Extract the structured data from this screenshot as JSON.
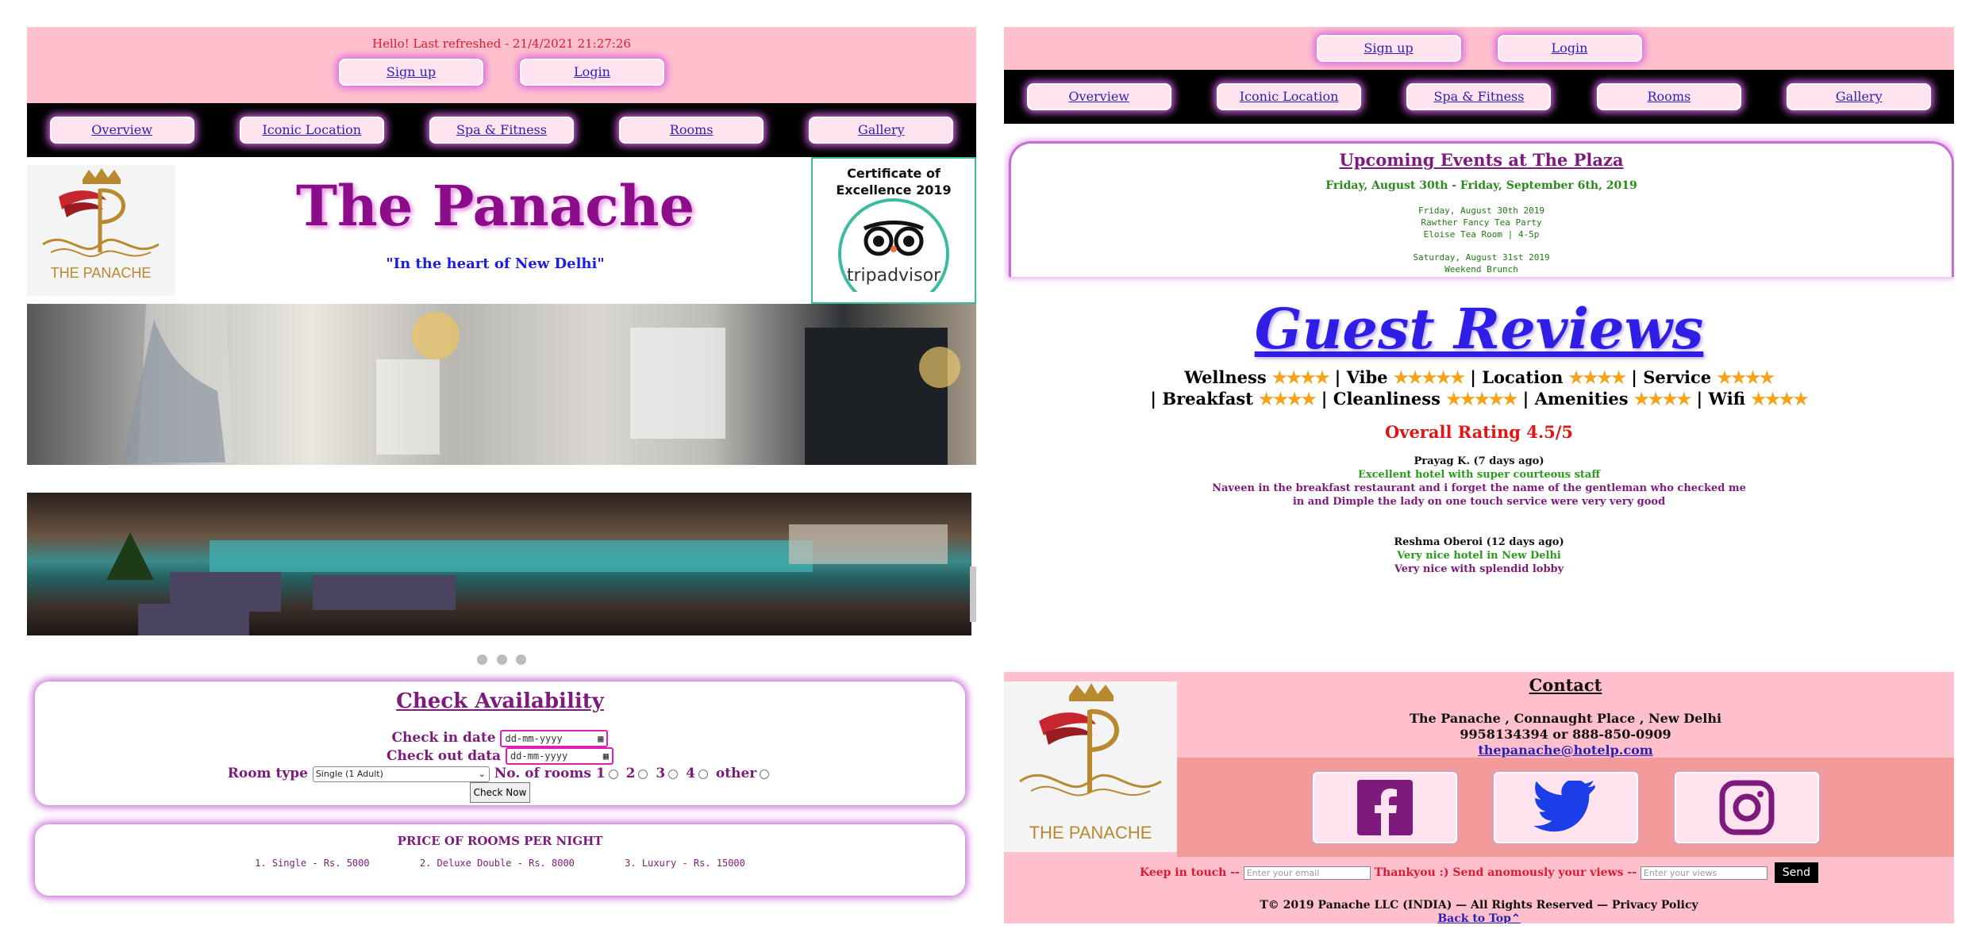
{
  "left": {
    "greeting": "Hello! Last refreshed - 21/4/2021 21:27:26",
    "auth": {
      "signup": "Sign up",
      "login": "Login"
    },
    "nav": [
      "Overview",
      "Iconic Location",
      "Spa & Fitness",
      "Rooms",
      "Gallery"
    ],
    "brand": {
      "logo_text": "THE PANACHE",
      "title": "The Panache",
      "tagline": "\"In the heart of New Delhi\"",
      "certificate": "Certificate of Excellence 2019",
      "certificate_brand": "tripadvisor"
    },
    "carousel_dots": 3,
    "availability": {
      "heading": "Check Availability",
      "checkin_label": "Check in date",
      "checkout_label": "Check out data",
      "date_placeholder": "dd-mm-yyyy",
      "roomtype_label": "Room type",
      "roomtype_value": "Single (1 Adult)",
      "rooms_label": "No. of rooms",
      "room_options": [
        "1",
        "2",
        "3",
        "4",
        "other"
      ],
      "submit": "Check Now"
    },
    "prices": {
      "heading": "PRICE OF ROOMS PER NIGHT",
      "items": [
        "1. Single - Rs. 5000",
        "2. Deluxe Double - Rs. 8000",
        "3. Luxury - Rs. 15000"
      ]
    }
  },
  "right": {
    "auth": {
      "signup": "Sign up",
      "login": "Login"
    },
    "nav": [
      "Overview",
      "Iconic Location",
      "Spa & Fitness",
      "Rooms",
      "Gallery"
    ],
    "events": {
      "heading": "Upcoming Events at The Plaza",
      "range": "Friday, August 30th - Friday, September 6th, 2019",
      "e1": [
        "Friday, August 30th 2019",
        "Rawther Fancy Tea Party",
        "Eloise Tea Room | 4-5p"
      ],
      "e2": [
        "Saturday, August 31st 2019",
        "Weekend Brunch"
      ]
    },
    "reviews": {
      "heading": "Guest Reviews",
      "line1": [
        {
          "label": "Wellness",
          "stars": "★★★★"
        },
        {
          "label": "Vibe",
          "stars": "★★★★★"
        },
        {
          "label": "Location",
          "stars": "★★★★"
        },
        {
          "label": "Service",
          "stars": "★★★★"
        }
      ],
      "line2": [
        {
          "label": "Breakfast",
          "stars": "★★★★"
        },
        {
          "label": "Cleanliness",
          "stars": "★★★★★"
        },
        {
          "label": "Amenities",
          "stars": "★★★★"
        },
        {
          "label": "Wifi",
          "stars": "★★★★"
        }
      ],
      "overall": "Overall Rating 4.5/5",
      "r1": {
        "name": "Prayag K. (7 days ago)",
        "headline": "Excellent hotel with super courteous staff",
        "body1": "Naveen in the breakfast restaurant and i forget the name of the gentleman who checked me",
        "body2": "in and Dimple the lady on one touch service were very very good"
      },
      "r2": {
        "name": "Reshma Oberoi (12 days ago)",
        "headline": "Very nice hotel in New Delhi",
        "body1": "Very nice with splendid lobby"
      }
    },
    "contact": {
      "heading": "Contact",
      "address": "The Panache , Connaught Place , New Delhi",
      "phone": "9958134394 or 888-850-0909",
      "email": "thepanache@hotelp.com",
      "logo_text": "THE PANACHE",
      "keep_label": "Keep in touch --",
      "email_placeholder": "Enter your email",
      "views_label": "Thankyou :) Send anomously your views --",
      "views_placeholder": "Enter your views",
      "send": "Send",
      "copyright": "T© 2019 Panache LLC (INDIA) — All Rights Reserved — Privacy Policy",
      "back": "Back to Top"
    }
  },
  "colors": {
    "pink": "#ffc0cb",
    "purple": "#7e1a7b",
    "nav_glow": "#d660e8",
    "link": "#2a1fb6",
    "red": "#d81b36",
    "green": "#2a8a1b"
  }
}
